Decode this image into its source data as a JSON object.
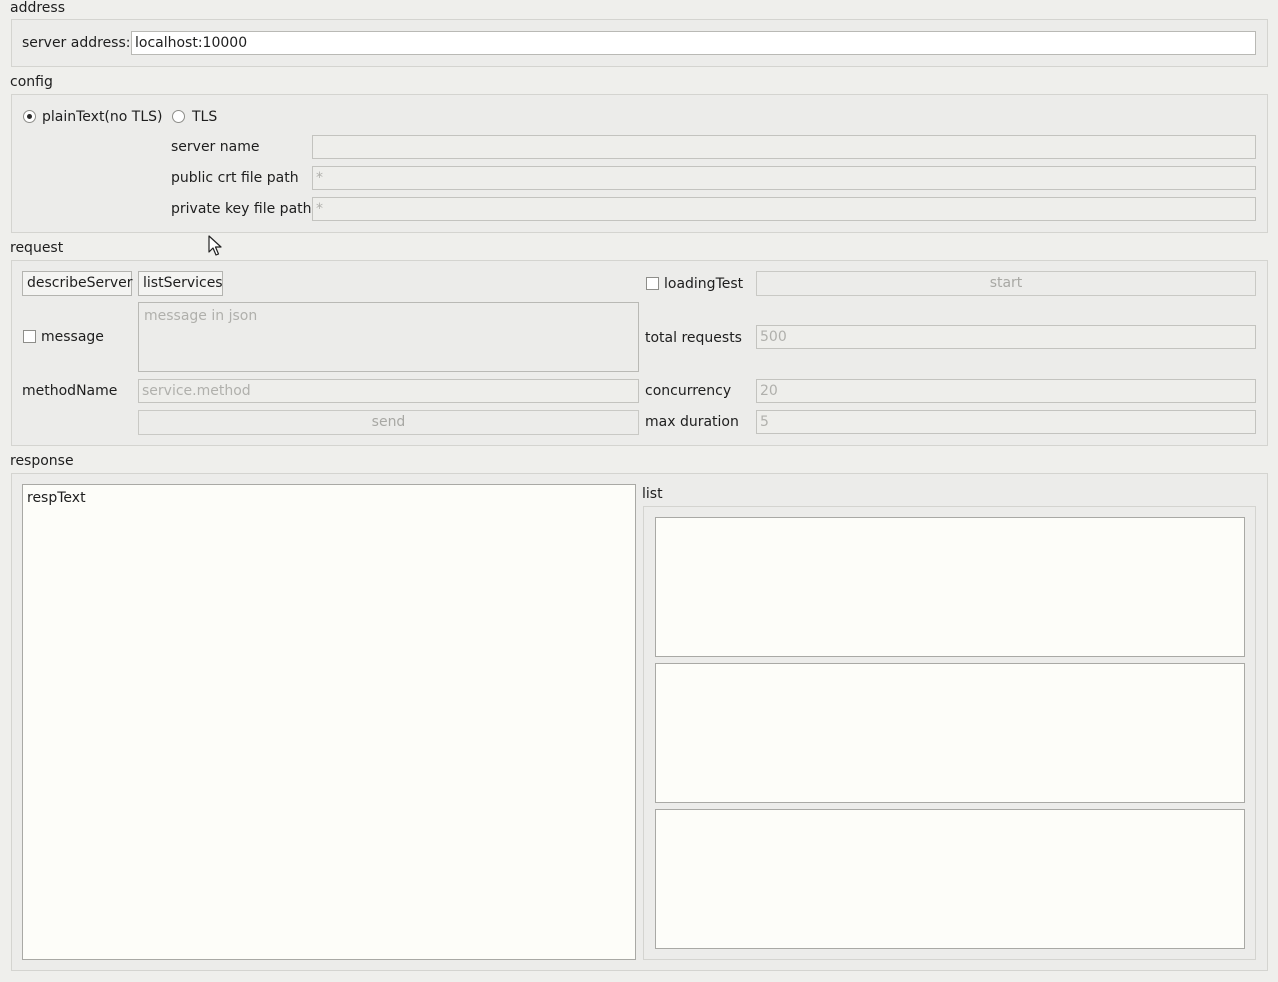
{
  "address": {
    "title": "address",
    "server_label": "server address:",
    "server_value": "localhost:10000"
  },
  "config": {
    "title": "config",
    "plaintext_label": "plainText(no TLS)",
    "plaintext_checked": true,
    "tls_label": "TLS",
    "tls_checked": false,
    "server_name_label": "server name",
    "server_name_value": "",
    "public_crt_label": "public crt file path",
    "public_crt_placeholder": "*",
    "private_key_label": "private key file path",
    "private_key_placeholder": "*"
  },
  "request": {
    "title": "request",
    "describe_button": "describeServer",
    "list_services_button": "listServices",
    "loading_test_label": "loadingTest",
    "start_button": "start",
    "message_label": "message",
    "message_placeholder": "message in json",
    "total_requests_label": "total requests",
    "total_requests_placeholder": "500",
    "method_label": "methodName",
    "method_placeholder": "service.method",
    "concurrency_label": "concurrency",
    "concurrency_placeholder": "20",
    "send_button": "send",
    "max_duration_label": "max duration",
    "max_duration_placeholder": "5"
  },
  "response": {
    "title": "response",
    "resp_text": "respText",
    "list_title": "list"
  }
}
